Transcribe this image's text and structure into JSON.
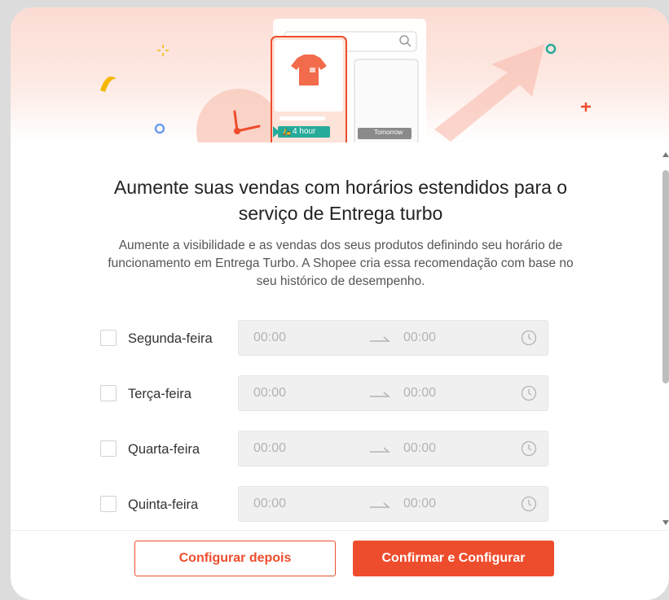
{
  "banner": {
    "badge_fast": "4 hour",
    "badge_slow": "Tomorrow"
  },
  "title_lines": [
    "Aumente suas vendas com horários estendidos para o",
    "serviço de Entrega turbo"
  ],
  "description_lines": [
    "Aumente a visibilidade e as vendas dos seus produtos definindo seu horário de",
    "funcionamento em Entrega Turbo. A Shopee cria essa recomendação com base no",
    "seu histórico de desempenho."
  ],
  "days": [
    {
      "label": "Segunda-feira",
      "start": "00:00",
      "end": "00:00",
      "checked": false
    },
    {
      "label": "Terça-feira",
      "start": "00:00",
      "end": "00:00",
      "checked": false
    },
    {
      "label": "Quarta-feira",
      "start": "00:00",
      "end": "00:00",
      "checked": false
    },
    {
      "label": "Quinta-feira",
      "start": "00:00",
      "end": "00:00",
      "checked": false
    }
  ],
  "buttons": {
    "later": "Configurar depois",
    "confirm": "Confirmar e Configurar"
  },
  "colors": {
    "brand": "#ee4d2d",
    "badge_green": "#26aa99"
  },
  "icons": [
    "search-icon",
    "clock-icon",
    "arrow-right-icon",
    "tshirt-icon",
    "scooter-icon",
    "truck-icon"
  ]
}
